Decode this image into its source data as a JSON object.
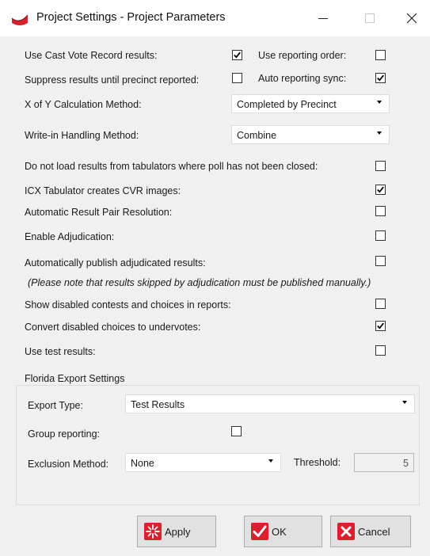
{
  "window": {
    "title": "Project Settings - Project Parameters",
    "controls": {
      "minimize": "—",
      "close": "X"
    }
  },
  "settings": {
    "use_cvr": {
      "label": "Use Cast Vote Record results:",
      "checked": true
    },
    "use_reporting_order": {
      "label": "Use reporting order:",
      "checked": false
    },
    "suppress_results": {
      "label": "Suppress results until precinct reported:",
      "checked": false
    },
    "auto_reporting_sync": {
      "label": "Auto reporting sync:",
      "checked": true
    },
    "xofy_method": {
      "label": "X of Y Calculation Method:",
      "value": "Completed by Precinct"
    },
    "writein_method": {
      "label": "Write-in Handling Method:",
      "value": "Combine"
    },
    "no_load_unclosed": {
      "label": "Do not load results from tabulators where poll has not been closed:",
      "checked": false
    },
    "icx_cvr_images": {
      "label": "ICX Tabulator creates CVR images:",
      "checked": true
    },
    "auto_pair_resolution": {
      "label": "Automatic Result Pair Resolution:",
      "checked": false
    },
    "enable_adjudication": {
      "label": "Enable Adjudication:",
      "checked": false
    },
    "auto_publish_adjudicated": {
      "label": "Automatically publish adjudicated results:",
      "checked": false
    },
    "adjudication_note": "(Please note that results skipped by adjudication must be published manually.)",
    "show_disabled": {
      "label": "Show disabled contests and choices in reports:",
      "checked": false
    },
    "convert_disabled": {
      "label": "Convert disabled choices to undervotes:",
      "checked": true
    },
    "use_test_results": {
      "label": "Use test results:",
      "checked": false
    }
  },
  "florida": {
    "group_title": "Florida Export Settings",
    "export_type": {
      "label": "Export Type:",
      "value": "Test Results"
    },
    "group_reporting": {
      "label": "Group reporting:",
      "checked": false
    },
    "exclusion_method": {
      "label": "Exclusion Method:",
      "value": "None"
    },
    "threshold": {
      "label": "Threshold:",
      "value": "5"
    }
  },
  "buttons": {
    "apply": "Apply",
    "ok": "OK",
    "cancel": "Cancel"
  },
  "colors": {
    "accent_red": "#d9202f",
    "window_bg": "#f0f0f0",
    "titlebar_bg": "#ffffff"
  }
}
